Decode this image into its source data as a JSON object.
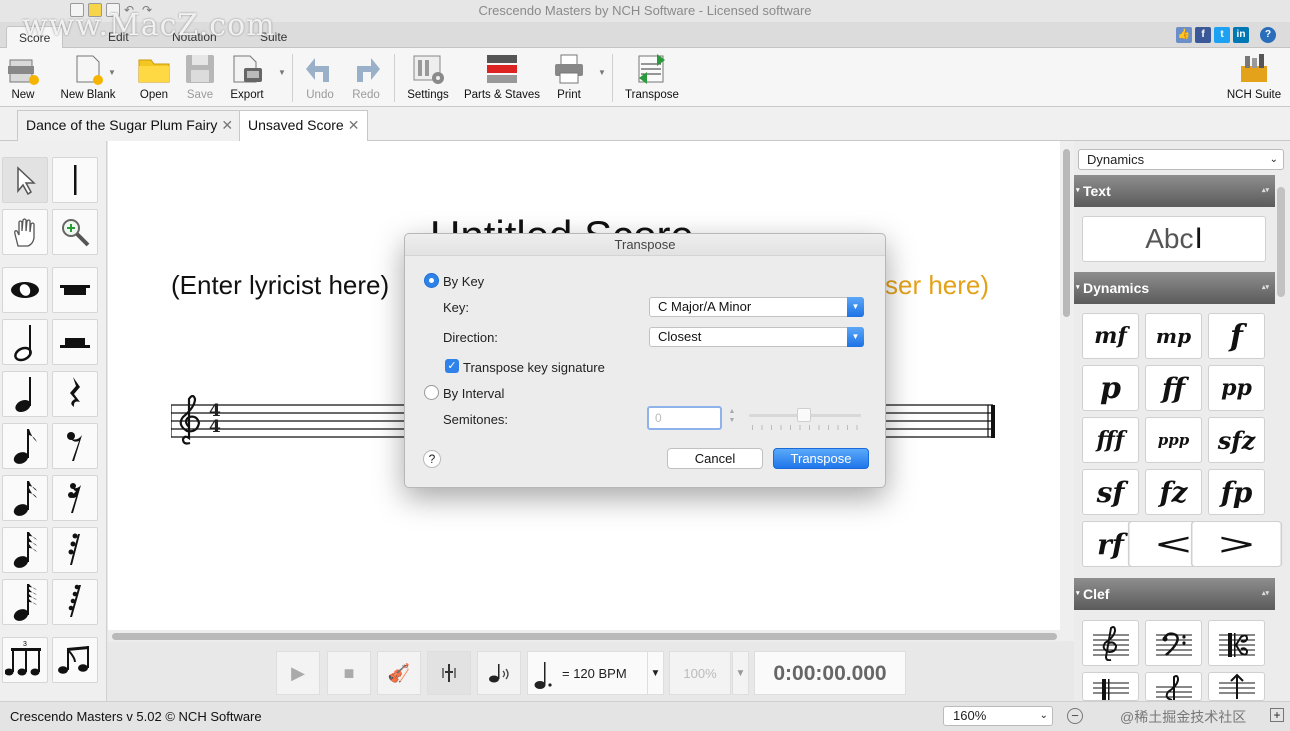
{
  "app": {
    "title": "Crescendo Masters by NCH Software - Licensed software",
    "watermark": "www.MacZ.com"
  },
  "menu_tabs": [
    "Score",
    "Edit",
    "Notation",
    "Suite"
  ],
  "toolbar": {
    "new": "New",
    "new_blank": "New Blank",
    "open": "Open",
    "save": "Save",
    "export": "Export",
    "undo": "Undo",
    "redo": "Redo",
    "settings": "Settings",
    "parts_staves": "Parts & Staves",
    "print": "Print",
    "transpose": "Transpose",
    "nch_suite": "NCH Suite"
  },
  "doc_tabs": [
    "Dance of the Sugar Plum Fairy",
    "Unsaved Score"
  ],
  "score": {
    "title": "Untitled Score",
    "lyricist": "(Enter lyricist here)",
    "composer": "ser here)",
    "time_signature": "4/4"
  },
  "right_panel": {
    "category": "Dynamics",
    "sections": {
      "text": "Text",
      "dynamics": "Dynamics",
      "clef": "Clef"
    },
    "text_sample": "Abc",
    "dynamics": [
      "mf",
      "mp",
      "f",
      "p",
      "ff",
      "pp",
      "fff",
      "ppp",
      "sfz",
      "sf",
      "fz",
      "fp",
      "rf",
      "<",
      ">"
    ]
  },
  "dialog": {
    "title": "Transpose",
    "by_key": "By Key",
    "key_label": "Key:",
    "key_value": "C Major/A Minor",
    "direction_label": "Direction:",
    "direction_value": "Closest",
    "transpose_key_sig": "Transpose key signature",
    "by_interval": "By Interval",
    "semitones_label": "Semitones:",
    "semitones_value": "0",
    "help": "?",
    "cancel": "Cancel",
    "ok": "Transpose"
  },
  "transport": {
    "tempo": "= 120 BPM",
    "volume": "100%",
    "time": "0:00:00.000"
  },
  "status": {
    "text": "Crescendo Masters v 5.02 © NCH Software",
    "zoom": "160%",
    "source_watermark": "@稀土掘金技术社区"
  },
  "colors": {
    "accent": "#2f82e9",
    "composer": "#e3a21a"
  }
}
